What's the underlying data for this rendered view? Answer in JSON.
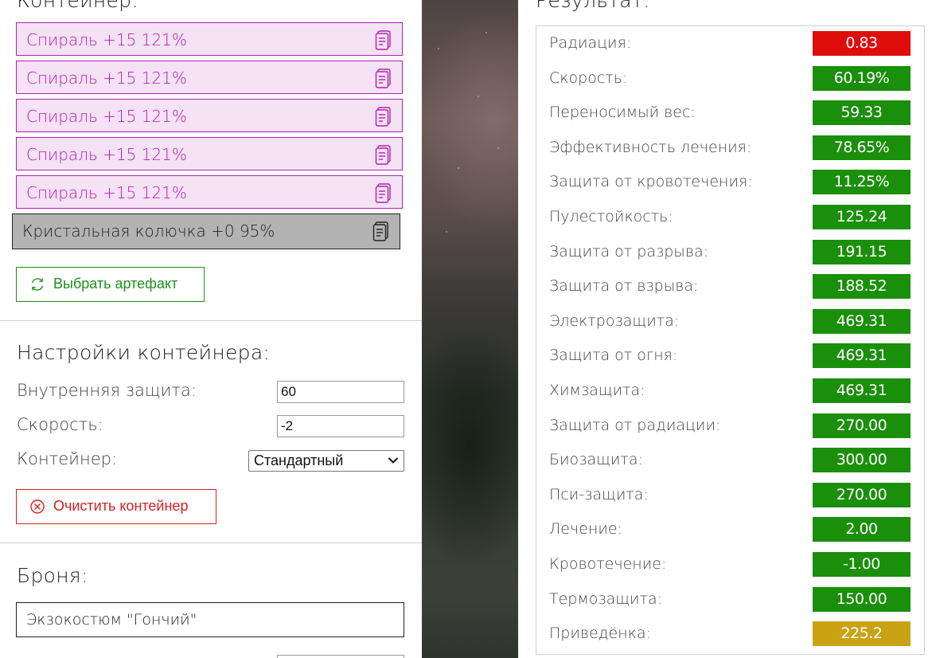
{
  "container": {
    "title": "Контейнер:",
    "artifacts": [
      {
        "name": "Спираль +15 121%",
        "icon": "document-icon",
        "color": "#b21fb2"
      },
      {
        "name": "Спираль +15 121%",
        "icon": "document-icon",
        "color": "#b21fb2"
      },
      {
        "name": "Спираль +15 121%",
        "icon": "document-icon",
        "color": "#b21fb2"
      },
      {
        "name": "Спираль +15 121%",
        "icon": "document-icon",
        "color": "#b21fb2"
      },
      {
        "name": "Спираль +15 121%",
        "icon": "document-icon",
        "color": "#b21fb2"
      },
      {
        "name": "Кристальная колючка +0 95%",
        "icon": "document-icon",
        "color": "#222222"
      }
    ],
    "choose_button": {
      "label": "Выбрать артефакт",
      "icon": "refresh-icon",
      "color": "#1e8f1e"
    }
  },
  "settings": {
    "title": "Настройки контейнера:",
    "internal_protection_label": "Внутренняя защита:",
    "internal_protection_value": "60",
    "speed_label": "Скорость:",
    "speed_value": "-2",
    "container_label": "Контейнер:",
    "container_value": "Стандартный",
    "clear_button": {
      "label": "Очистить контейнер",
      "icon": "close-circle-icon",
      "color": "#d62020"
    }
  },
  "armor": {
    "title": "Броня:",
    "value": "Экзокостюм \"Гончий\""
  },
  "results": {
    "title": "Результат:",
    "rows": [
      {
        "label": "Радиация:",
        "value": "0.83",
        "color": "#e00d0d"
      },
      {
        "label": "Скорость:",
        "value": "60.19%",
        "color": "#1a8f0a"
      },
      {
        "label": "Переносимый вес:",
        "value": "59.33",
        "color": "#1a8f0a"
      },
      {
        "label": "Эффективность лечения:",
        "value": "78.65%",
        "color": "#1a8f0a"
      },
      {
        "label": "Защита от кровотечения:",
        "value": "11.25%",
        "color": "#1a8f0a"
      },
      {
        "label": "Пулестойкость:",
        "value": "125.24",
        "color": "#1a8f0a"
      },
      {
        "label": "Защита от разрыва:",
        "value": "191.15",
        "color": "#1a8f0a"
      },
      {
        "label": "Защита от взрыва:",
        "value": "188.52",
        "color": "#1a8f0a"
      },
      {
        "label": "Электрозащита:",
        "value": "469.31",
        "color": "#1a8f0a"
      },
      {
        "label": "Защита от огня:",
        "value": "469.31",
        "color": "#1a8f0a"
      },
      {
        "label": "Химзащита:",
        "value": "469.31",
        "color": "#1a8f0a"
      },
      {
        "label": "Защита от радиации:",
        "value": "270.00",
        "color": "#1a8f0a"
      },
      {
        "label": "Биозащита:",
        "value": "300.00",
        "color": "#1a8f0a"
      },
      {
        "label": "Пси-защита:",
        "value": "270.00",
        "color": "#1a8f0a"
      },
      {
        "label": "Лечение:",
        "value": "2.00",
        "color": "#1a8f0a"
      },
      {
        "label": "Кровотечение:",
        "value": "-1.00",
        "color": "#1a8f0a"
      },
      {
        "label": "Термозащита:",
        "value": "150.00",
        "color": "#1a8f0a"
      },
      {
        "label": "Приведёнка:",
        "value": "225.2",
        "color": "#c9a314"
      }
    ]
  }
}
